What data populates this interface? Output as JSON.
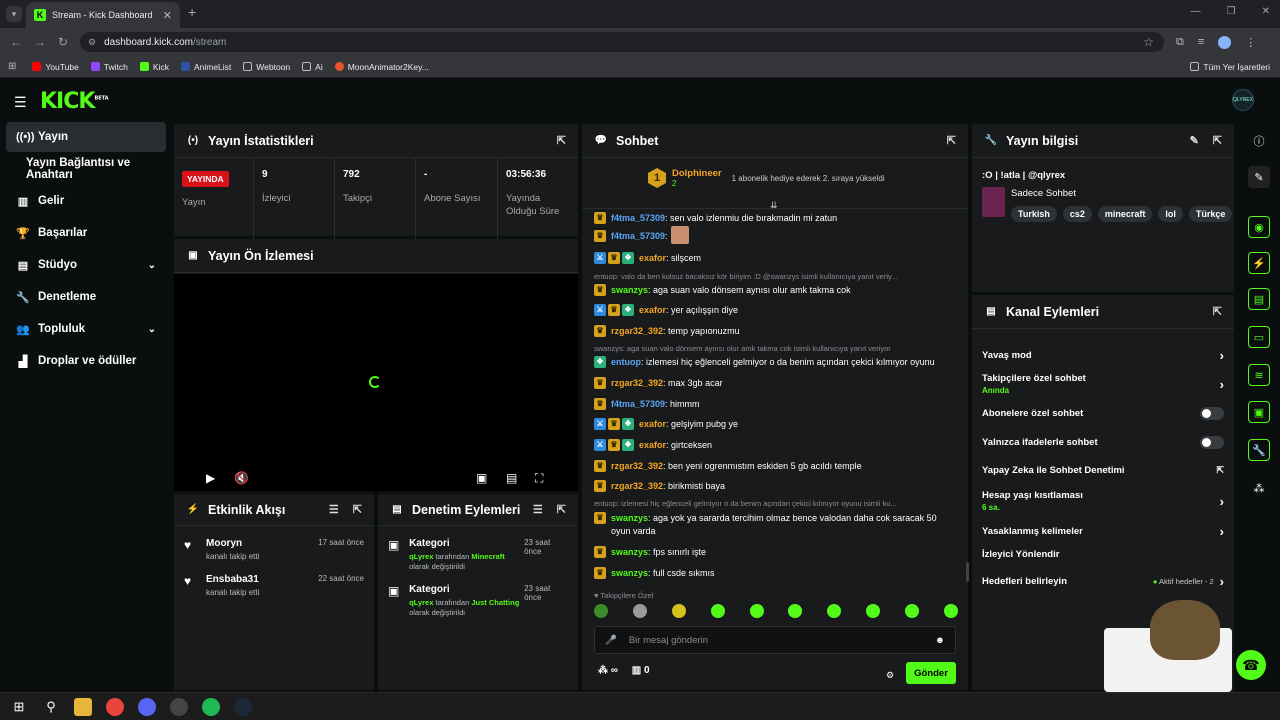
{
  "browser": {
    "tab_title": "Stream - Kick Dashboard",
    "url_host": "dashboard.kick.com",
    "url_path": "/stream",
    "bookmarks": [
      "YouTube",
      "Twitch",
      "Kick",
      "AnimeList",
      "Webtoon",
      "Ai",
      "MoonAnimator2Key..."
    ],
    "bookmarks_right": "Tüm Yer İşaretleri"
  },
  "app": {
    "logo": "KICK",
    "logo_sup": "BETA",
    "profile": "QLYREX"
  },
  "sidebar": {
    "items": [
      {
        "label": "Yayın",
        "icon": "broadcast-icon"
      },
      {
        "label": "Yayın Bağlantısı ve Anahtarı",
        "icon": ""
      },
      {
        "label": "Gelir",
        "icon": "revenue-icon"
      },
      {
        "label": "Başarılar",
        "icon": "trophy-icon"
      },
      {
        "label": "Stüdyo",
        "icon": "studio-icon"
      },
      {
        "label": "Denetleme",
        "icon": "wrench-icon"
      },
      {
        "label": "Topluluk",
        "icon": "community-icon"
      },
      {
        "label": "Droplar ve ödüller",
        "icon": "drops-icon"
      }
    ]
  },
  "stats": {
    "title": "Yayın İstatistikleri",
    "live_badge": "YAYINDA",
    "live_label": "Yayın",
    "cells": [
      {
        "value": "9",
        "label": "İzleyici"
      },
      {
        "value": "792",
        "label": "Takipçi"
      },
      {
        "value": "-",
        "label": "Abone Sayısı"
      },
      {
        "value": "03:56:36",
        "label": "Yayında Olduğu Süre"
      }
    ]
  },
  "preview": {
    "title": "Yayın Ön İzlemesi"
  },
  "activity": {
    "title": "Etkinlik Akışı",
    "events": [
      {
        "name": "Mooryn",
        "sub": "kanalı takip etti",
        "time": "17 saat önce"
      },
      {
        "name": "Ensbaba31",
        "sub": "kanalı takip etti",
        "time": "22 saat önce"
      }
    ]
  },
  "moderation": {
    "title": "Denetim Eylemleri",
    "events": [
      {
        "title": "Kategori",
        "user": "qLyrex",
        "mid": " tarafından ",
        "cat": "Minecraft",
        "end": " olarak değiştirildi",
        "time": "23 saat önce"
      },
      {
        "title": "Kategori",
        "user": "qLyrex",
        "mid": " tarafından ",
        "cat": "Just Chatting",
        "end": " olarak değiştirildi",
        "time": "23 saat önce"
      }
    ]
  },
  "chat": {
    "title": "Sohbet",
    "pinned_user": "Dolphineer",
    "pinned_count": "2",
    "pinned_rank": "1",
    "pinned_msg": "1 abonelik hediye ederek 2. sıraya yükseldi",
    "messages": [
      {
        "user": "f4tma_57309",
        "text": ": sen valo izlenmiu die bırakmadin mi zatun"
      },
      {
        "user": "f4tma_57309",
        "text": ":"
      },
      {
        "user": "exafor",
        "text": ": silşcem"
      },
      {
        "reply": "entuop: valo da ben kolsuz bacaksız kör biriyim :D @swanzys isimli kullanıcıya yanıt veriy..."
      },
      {
        "user": "swanzys",
        "text": ": aga suan valo dönsem aynısı olur amk takma cok"
      },
      {
        "user": "exafor",
        "text": ": yer açılışşın diye"
      },
      {
        "user": "rzgar32_392",
        "text": ": temp yapıonuzmu"
      },
      {
        "reply": "swanzys: aga suan valo dönsem aynısı olur amk takma cok isimli kullanıcıya yanıt veriyor"
      },
      {
        "user": "entuop",
        "text": ": izlemesi hiç eğlenceli gelmiyor o da benim açından çekici kılmıyor oyunu"
      },
      {
        "user": "rzgar32_392",
        "text": ": max 3gb acar"
      },
      {
        "user": "f4tma_57309",
        "text": ": himmm"
      },
      {
        "user": "exafor",
        "text": ": gelşiyim pubg ye"
      },
      {
        "user": "exafor",
        "text": ": girtceksen"
      },
      {
        "user": "rzgar32_392",
        "text": ": ben yeni ogrenmıstım eskiden 5 gb acıldı temple"
      },
      {
        "user": "rzgar32_392",
        "text": ": birikmisti baya"
      },
      {
        "reply": "entuop: izlemesi hiç eğlenceli gelmiyor o da benim açından çekici kılmıyor oyunu isimli ku..."
      },
      {
        "user": "swanzys",
        "text": ": aga yok ya sararda tercihim olmaz bence valodan daha cok saracak 50 oyun varda"
      },
      {
        "user": "swanzys",
        "text": ": fps sınırlı işte"
      },
      {
        "user": "swanzys",
        "text": ": full csde sıkmıs"
      }
    ],
    "followers_only": "Takipçilere Özel",
    "input_placeholder": "Bir mesaj gönderin",
    "points": "0",
    "send": "Gönder"
  },
  "info": {
    "title": "Yayın bilgisi",
    "stream_title": ":O | !atla | @qlyrex",
    "category": "Sadece Sohbet",
    "tags": [
      "Turkish",
      "cs2",
      "minecraft",
      "lol",
      "Türkçe"
    ]
  },
  "actions": {
    "title": "Kanal Eylemleri",
    "rows": [
      {
        "label": "Yavaş mod",
        "sub": "",
        "end": "chevron"
      },
      {
        "label": "Takipçilere özel sohbet",
        "sub": "Anında",
        "end": "chevron"
      },
      {
        "label": "Abonelere özel sohbet",
        "sub": "",
        "end": "toggle"
      },
      {
        "label": "Yalnızca ifadelerle sohbet",
        "sub": "",
        "end": "toggle"
      },
      {
        "label": "Yapay Zeka ile Sohbet Denetimi",
        "sub": "",
        "end": "external"
      },
      {
        "label": "Hesap yaşı kısıtlaması",
        "sub": "6 sa.",
        "end": "chevron"
      },
      {
        "label": "Yasaklanmış kelimeler",
        "sub": "",
        "end": "chevron"
      },
      {
        "label": "İzleyici Yönlendir",
        "sub": "",
        "end": ""
      },
      {
        "label": "Hedefleri belirleyin",
        "sub": "",
        "end": "chevron",
        "status": "Aktif hedefler - 2"
      }
    ]
  },
  "colors": {
    "accent": "#53fc18",
    "panel": "#181a1c",
    "live": "#d9121a",
    "user_blue": "#5ba8f5",
    "user_orange": "#f5a623",
    "user_green": "#53fc18"
  }
}
